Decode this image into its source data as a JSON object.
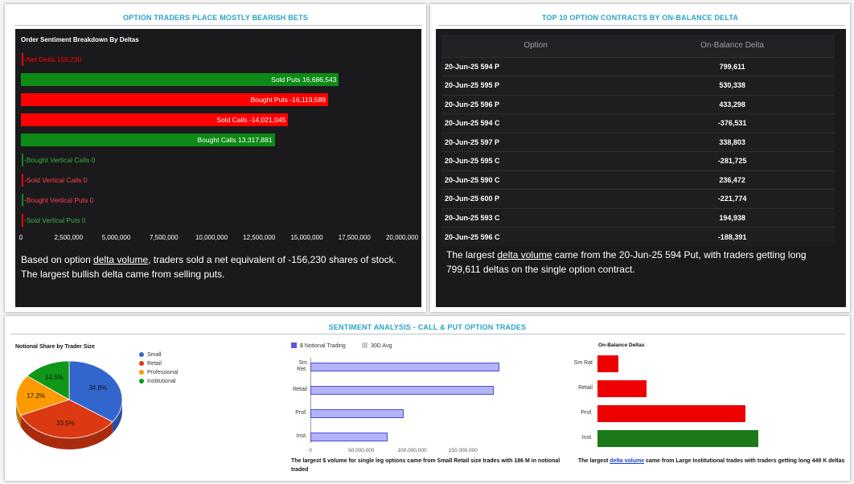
{
  "panel_left": {
    "title": "OPTION TRADERS PLACE MOSTLY BEARISH BETS",
    "chart_title": "Order Sentiment Breakdown By Deltas",
    "summary_pre": "Based on option ",
    "summary_link": "delta volume",
    "summary_post": ", traders sold a net equivalent of -156,230 shares of stock. The largest bullish delta came from selling puts.",
    "colors": {
      "positive": "#0e8a16",
      "negative": "#ff0000"
    }
  },
  "panel_right": {
    "title": "TOP 10 OPTION CONTRACTS BY ON-BALANCE DELTA",
    "columns": [
      "Option",
      "On-Balance Delta"
    ],
    "rows": [
      {
        "option": "20-Jun-25 594 P",
        "delta": "799,611"
      },
      {
        "option": "20-Jun-25 595 P",
        "delta": "530,338"
      },
      {
        "option": "20-Jun-25 596 P",
        "delta": "433,298"
      },
      {
        "option": "20-Jun-25 594 C",
        "delta": "-376,531"
      },
      {
        "option": "20-Jun-25 597 P",
        "delta": "338,803"
      },
      {
        "option": "20-Jun-25 595 C",
        "delta": "-281,725"
      },
      {
        "option": "20-Jun-25 590 C",
        "delta": "236,472"
      },
      {
        "option": "20-Jun-25 600 P",
        "delta": "-221,774"
      },
      {
        "option": "20-Jun-25 593 C",
        "delta": "194,938"
      },
      {
        "option": "20-Jun-25 596 C",
        "delta": "-188,391"
      }
    ],
    "summary_pre": "The largest ",
    "summary_link": "delta volume",
    "summary_post": " came from the 20-Jun-25 594 Put, with traders getting long 799,611 deltas on the single option contract."
  },
  "panel_bottom": {
    "title": "SENTIMENT ANALYSIS - CALL & PUT OPTION TRADES",
    "pie_title": "Notional Share by Trader Size",
    "pie_legend": [
      {
        "label": "Small",
        "color": "#3366cc"
      },
      {
        "label": "Retail",
        "color": "#dc3912"
      },
      {
        "label": "Professional",
        "color": "#ff9900"
      },
      {
        "label": "Institutional",
        "color": "#109618"
      }
    ],
    "bar_legend": {
      "notional": "$ Notional Trading",
      "avg": "30D Avg"
    },
    "bar_caption": "The largest $ volume for single leg options came from Small Retail size trades with 186 M in notional traded",
    "ob_title": "On-Balance Deltas",
    "ob_caption_pre": "The largest ",
    "ob_caption_link": "delta volume",
    "ob_caption_post": " came from Large Institutional trades with traders getting long 449 K deltas"
  },
  "chart_data": [
    {
      "type": "bar",
      "orientation": "horizontal",
      "title": "Order Sentiment Breakdown By Deltas",
      "categories": [
        "Net Delta",
        "Sold Puts",
        "Bought Puts",
        "Sold Calls",
        "Bought Calls",
        "Bought Vertical Calls",
        "Sold Vertical Calls",
        "Bought Vertical Puts",
        "Sold Vertical Puts"
      ],
      "values": [
        -156230,
        16686543,
        -16119589,
        -14021045,
        13317881,
        0,
        0,
        0,
        0
      ],
      "labels": [
        "Net Delta 156,230",
        "Sold Puts 16,686,543",
        "Bought Puts -16,119,589",
        "Sold Calls -14,021,045",
        "Bought Calls 13,317,881",
        "Bought Vertical Calls 0",
        "Sold Vertical Calls 0",
        "Bought Vertical Puts 0",
        "Sold Vertical Puts 0"
      ],
      "xlim": [
        0,
        20000000
      ],
      "xticks": [
        "0",
        "2,500,000",
        "5,000,000",
        "7,500,000",
        "10,000,000",
        "12,500,000",
        "15,000,000",
        "17,500,000",
        "20,000,000"
      ]
    },
    {
      "type": "pie",
      "title": "Notional Share by Trader Size",
      "categories": [
        "Small",
        "Retail",
        "Professional",
        "Institutional"
      ],
      "values": [
        34.8,
        33.5,
        17.2,
        14.5
      ],
      "labels": [
        "34.8%",
        "33.5%",
        "17.2%",
        "14.5%"
      ]
    },
    {
      "type": "bar",
      "orientation": "horizontal",
      "categories": [
        "Sm\nRet.",
        "Retail",
        "Prof.",
        "Inst."
      ],
      "series": [
        {
          "name": "$ Notional Trading",
          "values": [
            186000000,
            180000000,
            92000000,
            76000000
          ]
        },
        {
          "name": "30D Avg",
          "values": []
        }
      ],
      "xlim": [
        0,
        200000000
      ],
      "xticks": [
        "0",
        "50,000,000",
        "100,000,000",
        "150,000,000"
      ]
    },
    {
      "type": "bar",
      "orientation": "horizontal",
      "title": "On-Balance Deltas",
      "categories": [
        "Sm Rat",
        "Retail",
        "Prof.",
        "Inst."
      ],
      "values": [
        -59000,
        -136000,
        -412000,
        449000
      ]
    }
  ]
}
